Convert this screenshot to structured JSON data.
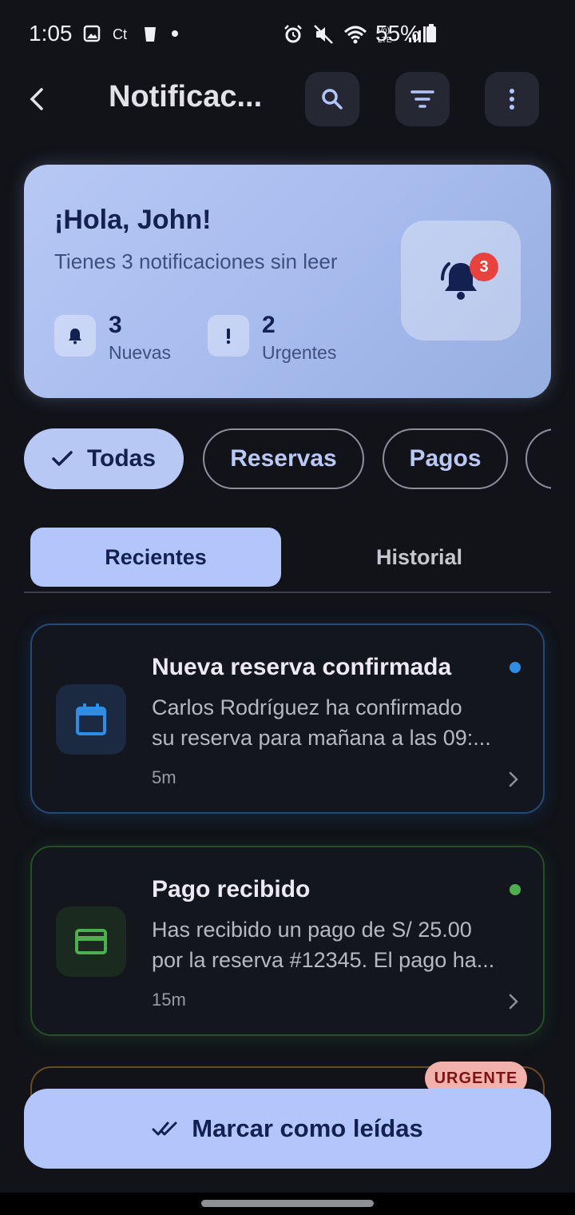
{
  "status_bar": {
    "time": "1:05",
    "battery": "55%",
    "icons": [
      "image-icon",
      "ct-icon",
      "cup-icon",
      "dot-icon",
      "alarm-icon",
      "mute-icon",
      "wifi-icon",
      "volte-icon",
      "signal-icon",
      "battery-icon"
    ]
  },
  "app_bar": {
    "title": "Notificac...",
    "actions": [
      "search-icon",
      "filter-icon",
      "more-vert-icon"
    ]
  },
  "greeting": {
    "title": "¡Hola, John!",
    "subtitle": "Tienes 3 notificaciones sin leer",
    "badge_count": "3",
    "stats": [
      {
        "value": "3",
        "label": "Nuevas",
        "icon": "bell-icon"
      },
      {
        "value": "2",
        "label": "Urgentes",
        "icon": "exclamation-icon"
      }
    ]
  },
  "filters": [
    {
      "label": "Todas",
      "selected": true
    },
    {
      "label": "Reservas",
      "selected": false
    },
    {
      "label": "Pagos",
      "selected": false
    }
  ],
  "tabs": [
    {
      "label": "Recientes",
      "active": true
    },
    {
      "label": "Historial",
      "active": false
    }
  ],
  "notifications": [
    {
      "title": "Nueva reserva confirmada",
      "body_line1": "Carlos Rodríguez ha confirmado",
      "body_line2": "su reserva para mañana a las 09:...",
      "time": "5m",
      "icon": "calendar-icon",
      "accent": "#2f8de4",
      "unread": true
    },
    {
      "title": "Pago recibido",
      "body_line1": "Has recibido un pago de S/ 25.00",
      "body_line2": "por la reserva #12345. El pago ha...",
      "time": "15m",
      "icon": "credit-card-icon",
      "accent": "#4caf50",
      "unread": true
    }
  ],
  "partial_card": {
    "badge": "URGENTE"
  },
  "bottom_action": {
    "label": "Marcar como leídas",
    "icon": "done-all-icon"
  },
  "colors": {
    "background": "#111318",
    "primary_container": "#b3c6fb",
    "on_primary": "#12214f",
    "urgent": "#f3b1ab"
  }
}
